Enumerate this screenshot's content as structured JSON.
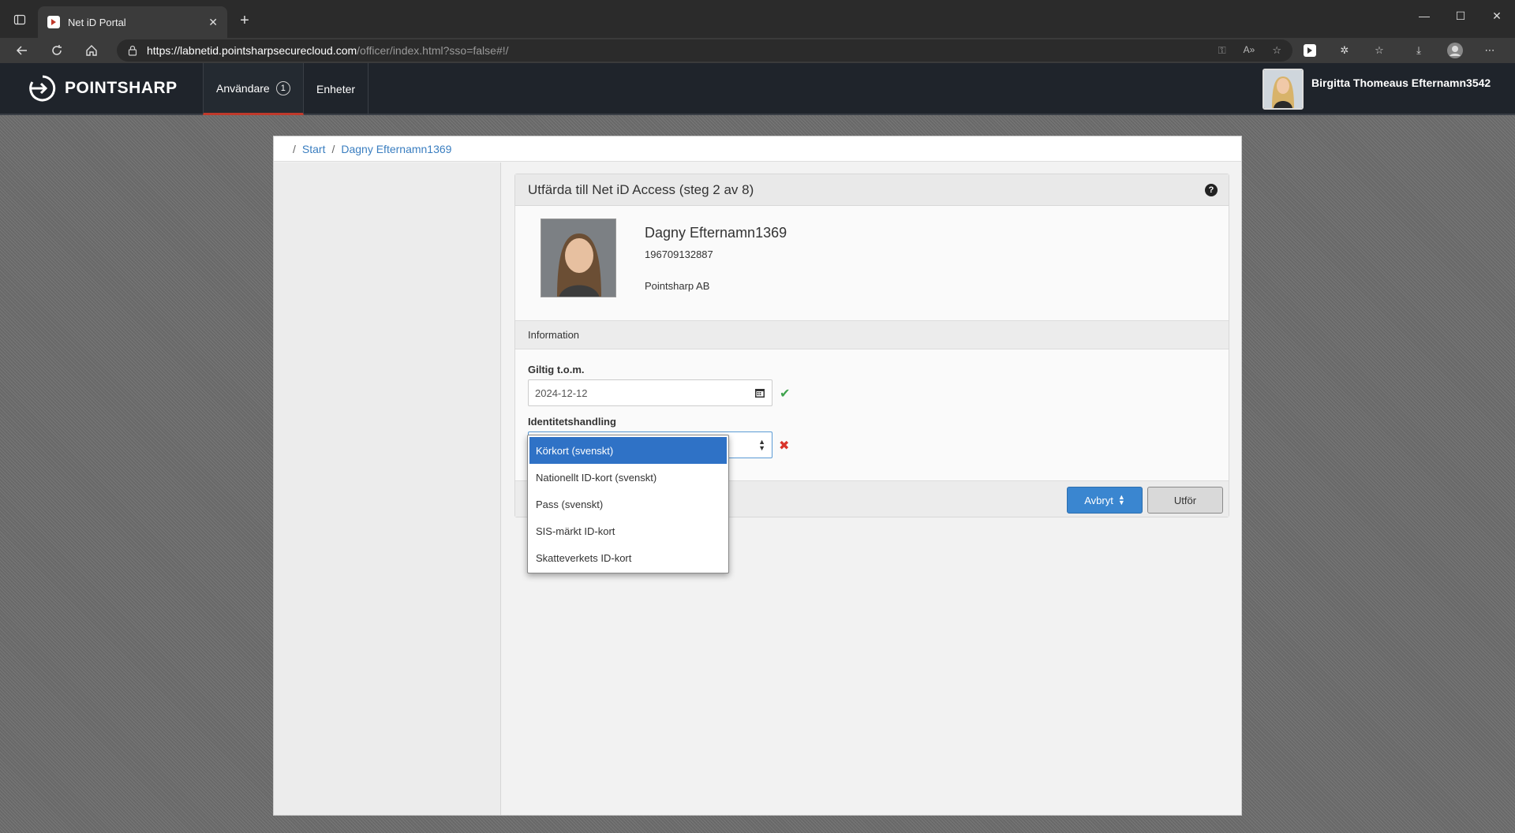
{
  "browser": {
    "tab_title": "Net iD Portal",
    "url_host": "https://labnetid.pointsharpsecurecloud.com",
    "url_path": "/officer/index.html?sso=false#!/"
  },
  "app": {
    "logo_text": "POINTSHARP",
    "nav": [
      {
        "label": "Användare",
        "badge": "1"
      },
      {
        "label": "Enheter"
      }
    ],
    "user_name": "Birgitta Thomeaus Efternamn3542"
  },
  "breadcrumb": {
    "sep": "/",
    "items": [
      "Start",
      "Dagny Efternamn1369"
    ]
  },
  "panel": {
    "title": "Utfärda till Net iD Access (steg 2 av 8)",
    "help": "?"
  },
  "person": {
    "name": "Dagny Efternamn1369",
    "personal_number": "196709132887",
    "organization": "Pointsharp AB"
  },
  "info_heading": "Information",
  "form": {
    "valid_label": "Giltig t.o.m.",
    "valid_value": "2024-12-12",
    "id_doc_label": "Identitetshandling",
    "id_doc_options": [
      "Körkort (svenskt)",
      "Nationellt ID-kort (svenskt)",
      "Pass (svenskt)",
      "SIS-märkt ID-kort",
      "Skatteverkets ID-kort"
    ],
    "highlighted_option": "Körkort (svenskt)"
  },
  "buttons": {
    "cancel": "Avbryt",
    "submit": "Utför"
  },
  "colors": {
    "primary": "#3a86d0",
    "header_bg": "#1f242b",
    "accent": "#c0392b",
    "success": "#3fa34d",
    "error": "#d9342b"
  }
}
